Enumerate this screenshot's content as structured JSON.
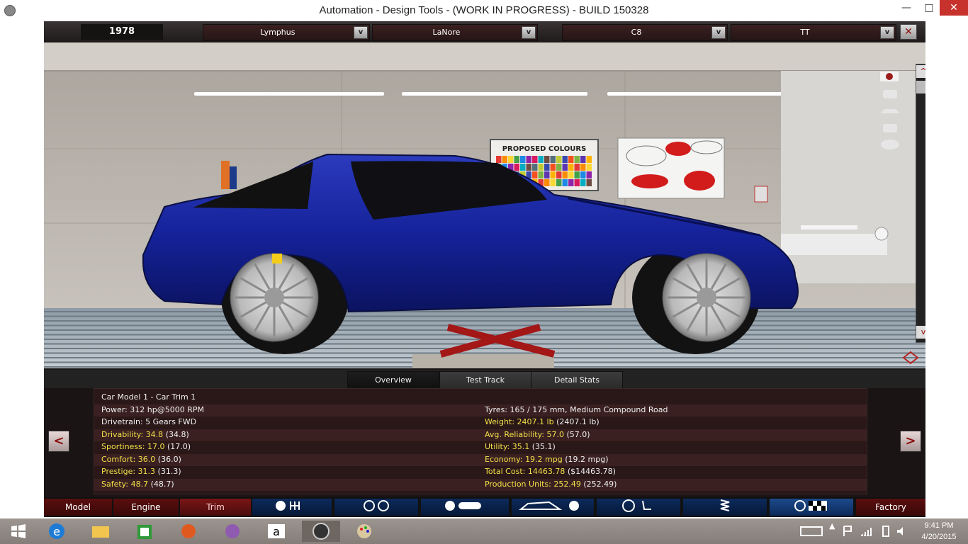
{
  "window": {
    "title": "Automation - Design Tools - (WORK IN PROGRESS) - BUILD 150328",
    "minimize": "—",
    "maximize": "□",
    "close": "✕"
  },
  "topbar": {
    "year": "1978",
    "dropdowns": [
      {
        "label": "Lymphus",
        "arrow": "v"
      },
      {
        "label": "LaNore",
        "arrow": "v"
      },
      {
        "label": "C8",
        "arrow": "v"
      },
      {
        "label": "TT",
        "arrow": "v"
      }
    ],
    "close_label": "✕"
  },
  "scene": {
    "poster_title": "PROPOSED COLOURS",
    "car_color": "#15229a"
  },
  "tabs": [
    {
      "label": "Overview",
      "active": true
    },
    {
      "label": "Test Track",
      "active": false
    },
    {
      "label": "Detail Stats",
      "active": false
    }
  ],
  "stats": {
    "model_name": "Car Model 1 - Car Trim 1",
    "left": [
      {
        "label": "Power:",
        "value": "312 hp@5000 RPM",
        "paren": "",
        "highlight": false
      },
      {
        "label": "Drivetrain:",
        "value": "5 Gears FWD",
        "paren": "",
        "highlight": false
      },
      {
        "label": "Drivability:",
        "value": "34.8",
        "paren": "(34.8)",
        "highlight": true
      },
      {
        "label": "Sportiness:",
        "value": "17.0",
        "paren": "(17.0)",
        "highlight": true
      },
      {
        "label": "Comfort:",
        "value": "36.0",
        "paren": "(36.0)",
        "highlight": true
      },
      {
        "label": "Prestige:",
        "value": "31.3",
        "paren": "(31.3)",
        "highlight": true
      },
      {
        "label": "Safety:",
        "value": "48.7",
        "paren": "(48.7)",
        "highlight": true
      }
    ],
    "right": [
      {
        "label": "Tyres:",
        "value": "165 / 175 mm, Medium Compound Road",
        "paren": "",
        "highlight": false
      },
      {
        "label": "Weight:",
        "value": "2407.1 lb",
        "paren": "(2407.1 lb)",
        "highlight": true
      },
      {
        "label": "Avg. Reliability:",
        "value": "57.0",
        "paren": "(57.0)",
        "highlight": true
      },
      {
        "label": "Utility:",
        "value": "35.1",
        "paren": "(35.1)",
        "highlight": true
      },
      {
        "label": "Economy:",
        "value": "19.2 mpg",
        "paren": "(19.2 mpg)",
        "highlight": true
      },
      {
        "label": "Total Cost:",
        "value": "14463.78",
        "paren": "($14463.78)",
        "highlight": true
      },
      {
        "label": "Production Units:",
        "value": "252.49",
        "paren": "(252.49)",
        "highlight": true
      }
    ]
  },
  "nav": {
    "prev": "<",
    "next": ">"
  },
  "bottom": {
    "model": "Model",
    "engine": "Engine",
    "trim": "Trim",
    "factory": "Factory"
  },
  "clock": {
    "time": "9:41 PM",
    "date": "4/20/2015"
  }
}
